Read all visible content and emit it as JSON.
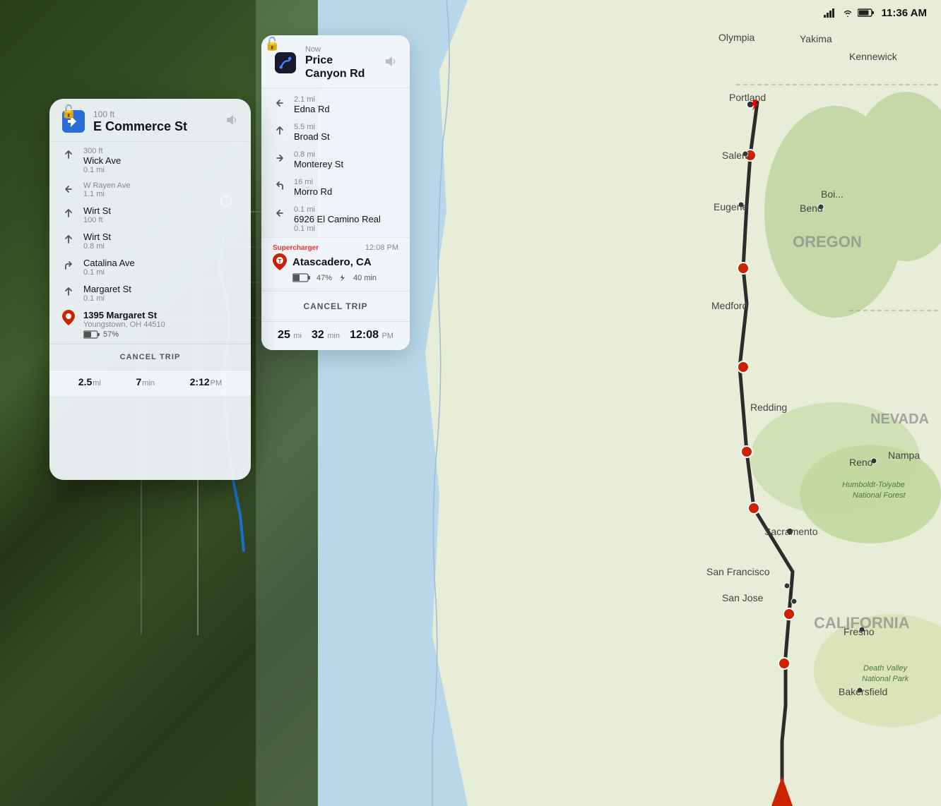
{
  "statusBar": {
    "time": "11:36 AM"
  },
  "leftPanel": {
    "lockIcon": "🔓",
    "header": {
      "distance": "100 ft",
      "street": "E Commerce St",
      "soundIcon": "🔊"
    },
    "turns": [
      {
        "distance": "300 ft",
        "street": "Wick Ave",
        "direction": "straight"
      },
      {
        "distance": "0.1 mi",
        "street": "",
        "direction": "straight"
      },
      {
        "distance": "",
        "street": "W Rayen Ave",
        "direction": "left"
      },
      {
        "distance": "1.1 mi",
        "street": "",
        "direction": ""
      },
      {
        "distance": "",
        "street": "Wirt St",
        "direction": "straight"
      },
      {
        "distance": "100 ft",
        "street": "",
        "direction": ""
      },
      {
        "distance": "",
        "street": "Wirt St",
        "direction": "straight"
      },
      {
        "distance": "0.8 mi",
        "street": "",
        "direction": ""
      },
      {
        "distance": "",
        "street": "Catalina Ave",
        "direction": "right"
      },
      {
        "distance": "0.1 mi",
        "street": "",
        "direction": ""
      },
      {
        "distance": "",
        "street": "Margaret St",
        "direction": "straight"
      },
      {
        "distance": "0.1 mi",
        "street": "",
        "direction": ""
      }
    ],
    "destination": {
      "name": "1395 Margaret St",
      "address": "Youngstown, OH 44510",
      "battery": "57%"
    },
    "cancelBtn": "CANCEL TRIP",
    "bottomStats": {
      "distance": "2.5",
      "distUnit": "mi",
      "time": "7",
      "timeUnit": "min",
      "eta": "2:12",
      "etaUnit": "PM"
    }
  },
  "navPanel": {
    "lockIcon": "🔓",
    "header": {
      "nowLabel": "Now",
      "street": "Price Canyon Rd",
      "soundIcon": "🔊"
    },
    "turns": [
      {
        "distance": "2.1 mi",
        "street": "Edna Rd",
        "direction": "left"
      },
      {
        "distance": "5.5 mi",
        "street": "Broad St",
        "direction": "straight"
      },
      {
        "distance": "0.8 mi",
        "street": "Monterey St",
        "direction": "right"
      },
      {
        "distance": "16 mi",
        "street": "Morro Rd",
        "direction": "left-sharp"
      },
      {
        "distance": "0.1 mi",
        "street": "6926 El Camino Real",
        "direction": "left"
      },
      {
        "distance": "0.1 mi",
        "street": "",
        "direction": ""
      }
    ],
    "supercharger": {
      "label": "Supercharger",
      "time": "12:08 PM",
      "name": "Atascadero, CA",
      "battery": "47%",
      "chargeTime": "40 min"
    },
    "cancelBtn": "CANCEL TRIP",
    "bottomStats": {
      "distance": "25",
      "distUnit": "mi",
      "time": "32",
      "timeUnit": "min",
      "eta": "12:08",
      "etaUnit": "PM"
    }
  },
  "map": {
    "cities": [
      "Portland",
      "Salem",
      "Eugene",
      "Medford",
      "Redding",
      "Sacramento",
      "San Francisco",
      "San Jose",
      "Fresno",
      "Bakersfield",
      "Reno",
      "Bend",
      "Yakima",
      "Kennewick",
      "Olympia"
    ],
    "regions": [
      "OREGON",
      "NEVADA",
      "CALIFORNIA"
    ],
    "parks": [
      "Humboldt-Toiyabe\nNational Forest",
      "Death Valley\nNational Park"
    ]
  },
  "icons": {
    "leftArrow": "←",
    "rightArrow": "→",
    "straightArrow": "↑",
    "sharpLeft": "↖",
    "destPin": "📍",
    "soundOn": "🔊",
    "lock": "🔓",
    "lightning": "⚡"
  }
}
